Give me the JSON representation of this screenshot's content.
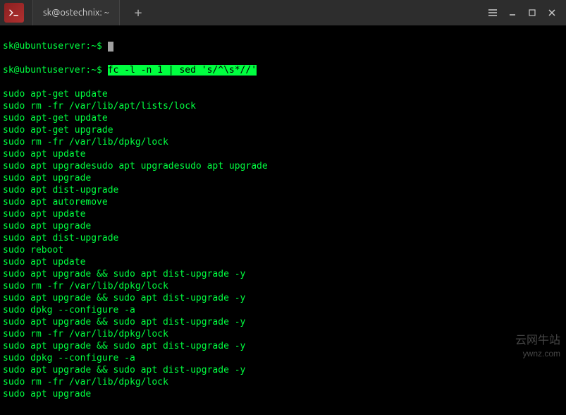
{
  "window": {
    "tab_title": "sk@ostechnix: ~",
    "new_tab_glyph": "+",
    "icons": {
      "app": "terminal-icon",
      "hamburger": "hamburger-icon",
      "minimize": "minimize-icon",
      "maximize": "maximize-icon",
      "close": "close-icon"
    }
  },
  "terminal": {
    "prompt_1": "sk@ubuntuserver:~$ ",
    "prompt_2": "sk@ubuntuserver:~$ ",
    "highlighted_command": "fc -l -n 1 | sed 's/^\\s*//'",
    "output_lines": [
      "sudo apt-get update",
      "sudo rm -fr /var/lib/apt/lists/lock",
      "sudo apt-get update",
      "sudo apt-get upgrade",
      "sudo rm -fr /var/lib/dpkg/lock",
      "sudo apt update",
      "sudo apt upgradesudo apt upgradesudo apt upgrade",
      "sudo apt upgrade",
      "sudo apt dist-upgrade",
      "sudo apt autoremove",
      "sudo apt update",
      "sudo apt upgrade",
      "sudo apt dist-upgrade",
      "sudo reboot",
      "sudo apt update",
      "sudo apt upgrade && sudo apt dist-upgrade -y",
      "sudo rm -fr /var/lib/dpkg/lock",
      "sudo apt upgrade && sudo apt dist-upgrade -y",
      "sudo dpkg --configure -a",
      "sudo apt upgrade && sudo apt dist-upgrade -y",
      "sudo rm -fr /var/lib/dpkg/lock",
      "sudo apt upgrade && sudo apt dist-upgrade -y",
      "sudo dpkg --configure -a",
      "sudo apt upgrade && sudo apt dist-upgrade -y",
      "sudo rm -fr /var/lib/dpkg/lock",
      "sudo apt upgrade"
    ]
  },
  "watermark": {
    "line1": "云网牛站",
    "line2": "ywnz.com"
  }
}
